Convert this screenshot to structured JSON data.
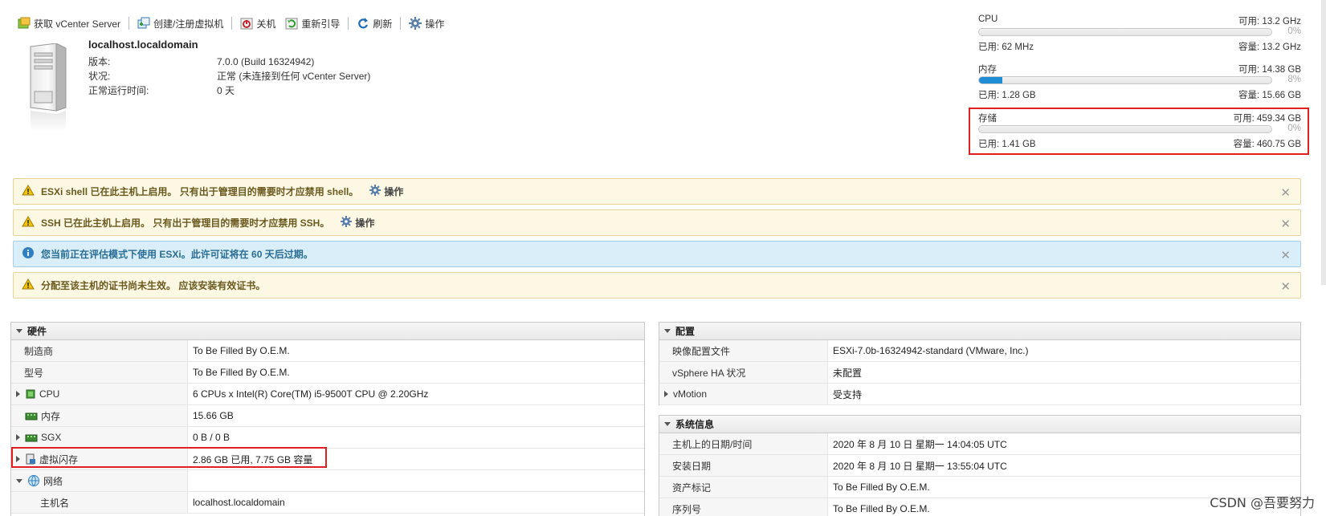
{
  "toolbar": {
    "get_vcenter": "获取 vCenter Server",
    "create_vm": "创建/注册虚拟机",
    "shutdown": "关机",
    "reboot": "重新引导",
    "refresh": "刷新",
    "actions": "操作"
  },
  "host": {
    "name": "localhost.localdomain",
    "rows": [
      {
        "label": "版本:",
        "value": "7.0.0 (Build 16324942)"
      },
      {
        "label": "状况:",
        "value": "正常 (未连接到任何 vCenter Server)"
      },
      {
        "label": "正常运行时间:",
        "value": "0 天"
      }
    ]
  },
  "meters": {
    "cpu": {
      "label": "CPU",
      "free": "可用: 13.2 GHz",
      "percent": "0%",
      "used": "已用: 62 MHz",
      "capacity": "容量: 13.2 GHz",
      "fill_fraction": 0.0
    },
    "memory": {
      "label": "内存",
      "free": "可用: 14.38 GB",
      "percent": "8%",
      "used": "已用: 1.28 GB",
      "capacity": "容量: 15.66 GB",
      "fill_fraction": 0.08
    },
    "storage": {
      "label": "存储",
      "free": "可用: 459.34 GB",
      "percent": "0%",
      "used": "已用: 1.41 GB",
      "capacity": "容量: 460.75 GB",
      "fill_fraction": 0.0
    }
  },
  "alerts": [
    {
      "type": "warning",
      "text": "ESXi shell 已在此主机上启用。 只有出于管理目的需要时才应禁用 shell。",
      "action": "操作"
    },
    {
      "type": "warning",
      "text": "SSH 已在此主机上启用。 只有出于管理目的需要时才应禁用 SSH。",
      "action": "操作"
    },
    {
      "type": "info",
      "text": "您当前正在评估模式下使用 ESXi。此许可证将在 60 天后过期。"
    },
    {
      "type": "warning",
      "text": "分配至该主机的证书尚未生效。 应该安装有效证书。"
    }
  ],
  "hardware": {
    "title": "硬件",
    "rows": [
      {
        "label": "制造商",
        "value": "To Be Filled By O.E.M."
      },
      {
        "label": "型号",
        "value": "To Be Filled By O.E.M."
      },
      {
        "label": "CPU",
        "value": "6 CPUs x Intel(R) Core(TM) i5-9500T CPU @ 2.20GHz"
      },
      {
        "label": "内存",
        "value": "15.66 GB"
      },
      {
        "label": "SGX",
        "value": "0 B / 0 B"
      },
      {
        "label": "虚拟闪存",
        "value": "2.86 GB 已用, 7.75 GB 容量"
      },
      {
        "label": "网络",
        "value": ""
      },
      {
        "label": "主机名",
        "value": "localhost.localdomain"
      }
    ]
  },
  "config": {
    "title": "配置",
    "rows": [
      {
        "label": "映像配置文件",
        "value": "ESXi-7.0b-16324942-standard (VMware, Inc.)"
      },
      {
        "label": "vSphere HA 状况",
        "value": "未配置"
      },
      {
        "label": "vMotion",
        "value": "受支持"
      }
    ]
  },
  "sysinfo": {
    "title": "系统信息",
    "rows": [
      {
        "label": "主机上的日期/时间",
        "value": "2020 年 8 月 10 日 星期一 14:04:05 UTC"
      },
      {
        "label": "安装日期",
        "value": "2020 年 8 月 10 日 星期一 13:55:04 UTC"
      },
      {
        "label": "资产标记",
        "value": "To Be Filled By O.E.M."
      },
      {
        "label": "序列号",
        "value": "To Be Filled By O.E.M."
      }
    ]
  },
  "watermark": "CSDN @吾要努力",
  "colors": {
    "alert_warning_bg": "#fdf8e4",
    "alert_info_bg": "#d9eef8",
    "meter_fill": "#1f8dd6",
    "highlight": "#e02020"
  }
}
